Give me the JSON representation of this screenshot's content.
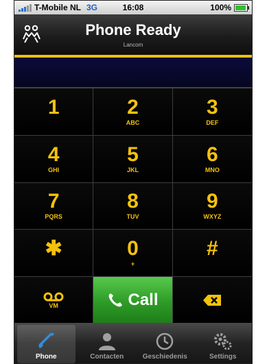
{
  "status": {
    "carrier": "T-Mobile NL",
    "network": "3G",
    "time": "16:08",
    "battery": "100%"
  },
  "header": {
    "title": "Phone Ready",
    "subtitle": "Lancom"
  },
  "display": {
    "number": ""
  },
  "keypad": [
    {
      "digit": "1",
      "letters": ""
    },
    {
      "digit": "2",
      "letters": "ABC"
    },
    {
      "digit": "3",
      "letters": "DEF"
    },
    {
      "digit": "4",
      "letters": "GHI"
    },
    {
      "digit": "5",
      "letters": "JKL"
    },
    {
      "digit": "6",
      "letters": "MNO"
    },
    {
      "digit": "7",
      "letters": "PQRS"
    },
    {
      "digit": "8",
      "letters": "TUV"
    },
    {
      "digit": "9",
      "letters": "WXYZ"
    },
    {
      "digit": "✱",
      "letters": ""
    },
    {
      "digit": "0",
      "letters": "+"
    },
    {
      "digit": "#",
      "letters": ""
    }
  ],
  "voicemail": {
    "label": "VM"
  },
  "call": {
    "label": "Call"
  },
  "tabs": [
    {
      "label": "Phone",
      "icon": "phone-icon"
    },
    {
      "label": "Contacten",
      "icon": "contacts-icon"
    },
    {
      "label": "Geschiedenis",
      "icon": "clock-icon"
    },
    {
      "label": "Settings",
      "icon": "gears-icon"
    }
  ],
  "colors": {
    "accent": "#f4c20d",
    "call_green": "#2d9b26",
    "display_bg": "#0b0b3a"
  }
}
